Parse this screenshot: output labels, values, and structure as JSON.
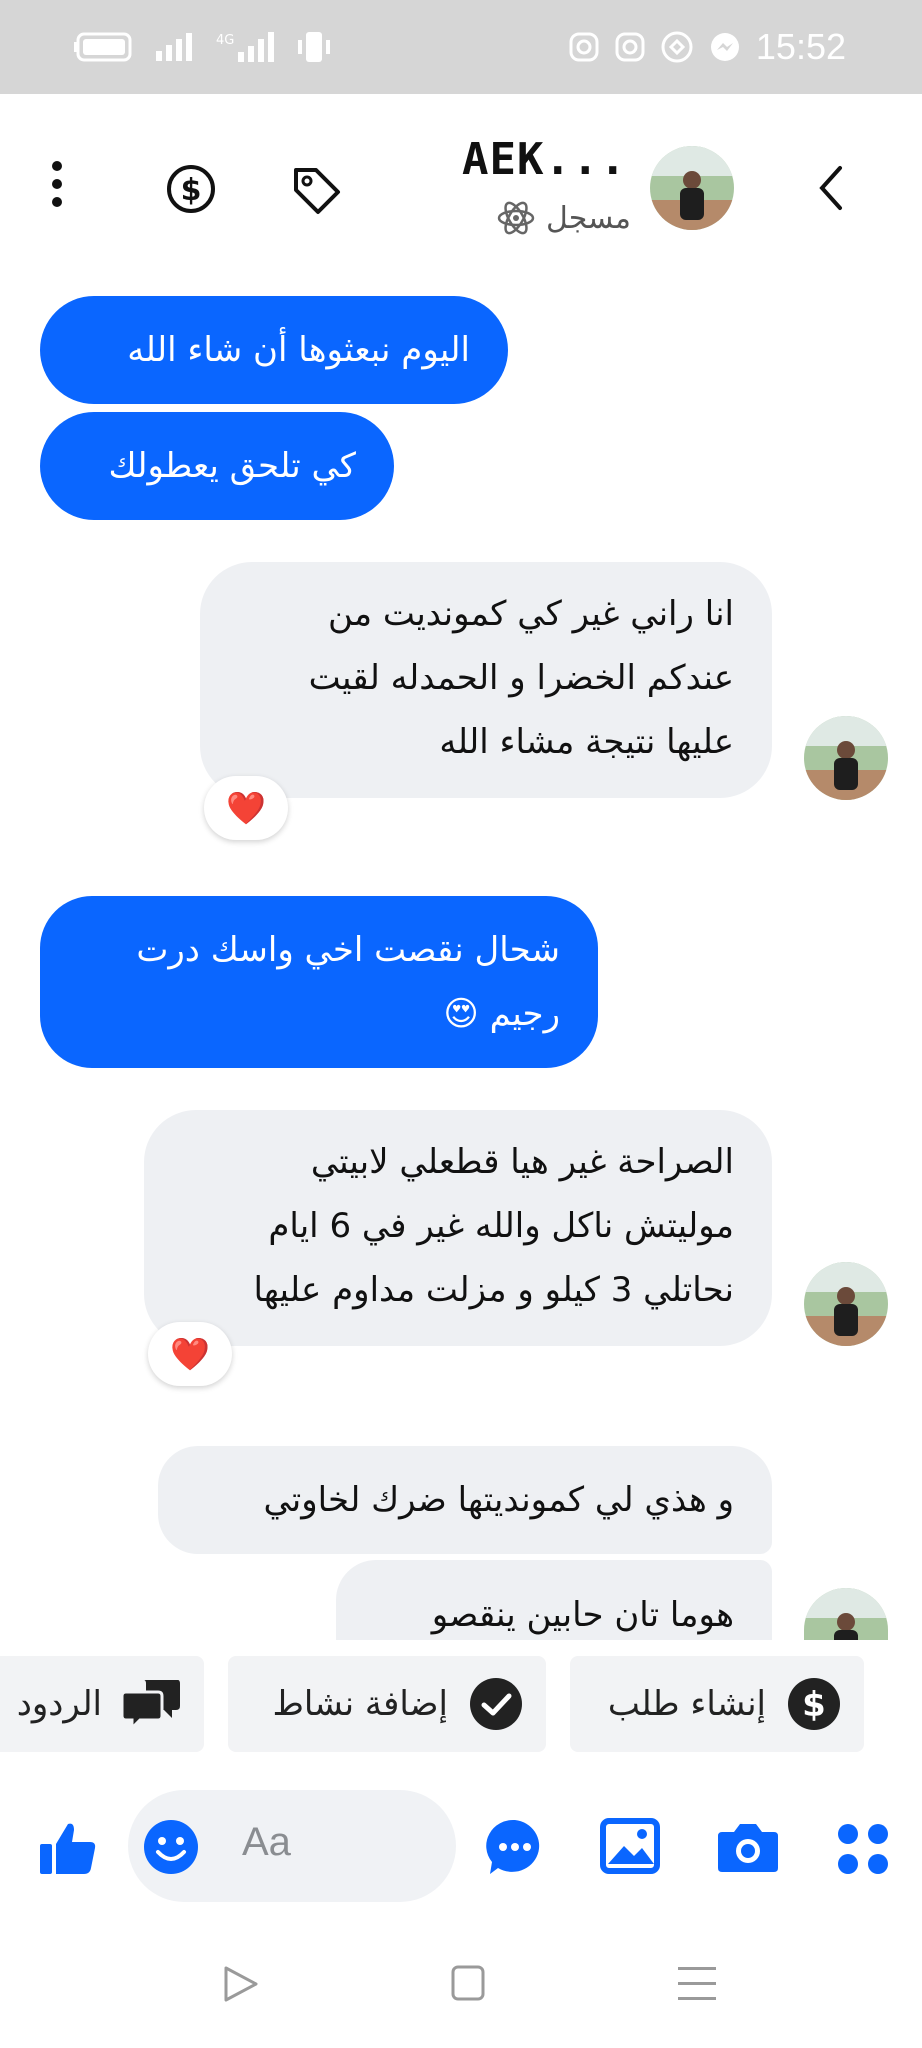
{
  "status_bar": {
    "time": "15:52"
  },
  "header": {
    "title": "AEK...",
    "subtitle": "مسجل"
  },
  "messages": [
    {
      "side": "out",
      "text": "اليوم نبعثوها أن شاء الله"
    },
    {
      "side": "out",
      "text": "كي تلحق يعطولك"
    },
    {
      "side": "in",
      "lines": [
        "انا راني غير كي كمونديت من",
        "عندكم الخضرا و الحمدله لقيت",
        "عليها نتيجة مشاء الله"
      ],
      "reaction": "❤️"
    },
    {
      "side": "out",
      "lines": [
        "شحال نقصت اخي واسك درت",
        "رجيم 😍"
      ]
    },
    {
      "side": "in",
      "lines": [
        "الصراحة غير هيا قطعلي لابيتي",
        "موليتش ناكل والله غير في 6 ايام",
        "نحاتلي 3 كيلو و مزلت مداوم عليها"
      ],
      "reaction": "❤️"
    },
    {
      "side": "in",
      "text": "و هذي لي كمونديتها ضرك لخاوتي"
    },
    {
      "side": "in",
      "text": "هوما تان حابين ينقصو"
    }
  ],
  "quick_actions": {
    "create_order": "إنشاء طلب",
    "add_activity": "إضافة نشاط",
    "replies": "الردود"
  },
  "composer": {
    "placeholder": "Aa"
  },
  "colors": {
    "accent": "#0a66ff",
    "incoming": "#eef0f3"
  }
}
